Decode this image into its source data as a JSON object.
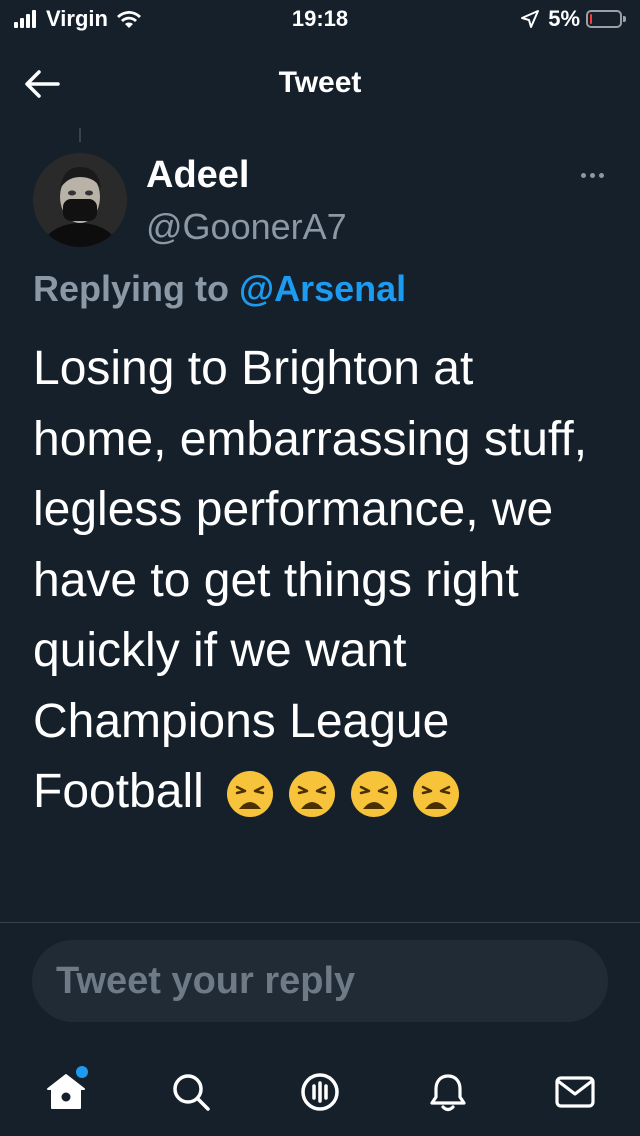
{
  "status_bar": {
    "carrier": "Virgin",
    "time": "19:18",
    "battery_percent": "5%",
    "battery_level": 0.05,
    "battery_color": "#ff3b30"
  },
  "header": {
    "title": "Tweet",
    "back_icon": "arrow-left-icon"
  },
  "tweet": {
    "author_name": "Adeel",
    "author_handle": "@GoonerA7",
    "replying_prefix": "Replying to",
    "replying_to": "@Arsenal",
    "text": "Losing to Brighton at home, embarrassing stuff, legless performance, we have to get things right quickly if we want Champions League Football",
    "emojis": [
      "😩",
      "😩",
      "😩",
      "😩"
    ],
    "more_icon": "more-horizontal-icon"
  },
  "reply": {
    "placeholder": "Tweet your reply"
  },
  "tab_bar": {
    "items": [
      {
        "name": "home",
        "icon": "home-icon",
        "has_notification": true
      },
      {
        "name": "search",
        "icon": "search-icon"
      },
      {
        "name": "spaces",
        "icon": "spaces-icon"
      },
      {
        "name": "notifications",
        "icon": "bell-icon"
      },
      {
        "name": "messages",
        "icon": "mail-icon"
      }
    ]
  },
  "colors": {
    "background": "#15202b",
    "accent": "#1d9bf0",
    "secondary_text": "#8b98a5",
    "input_bg": "#202b36"
  }
}
